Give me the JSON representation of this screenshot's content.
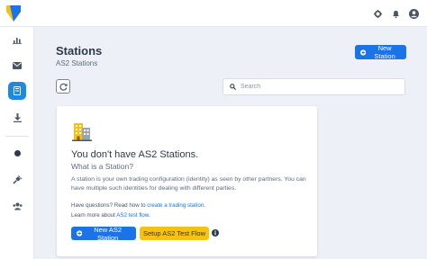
{
  "header": {
    "logo": "app-logo",
    "icons": [
      "gear-icon",
      "bell-icon",
      "user-circle-icon"
    ]
  },
  "sidebar": {
    "items": [
      {
        "icon": "bar-chart-icon",
        "active": false
      },
      {
        "icon": "envelope-icon",
        "active": false
      },
      {
        "icon": "station-icon",
        "active": true
      },
      {
        "icon": "download-icon",
        "active": false
      },
      {
        "icon": "circle-icon",
        "active": false
      },
      {
        "icon": "plug-icon",
        "active": false
      },
      {
        "icon": "users-icon",
        "active": false
      }
    ]
  },
  "page": {
    "title": "Stations",
    "subtitle": "AS2 Stations",
    "new_station_label": "New Station"
  },
  "search": {
    "placeholder": "Search"
  },
  "empty_state": {
    "title": "You don't have AS2 Stations.",
    "question": "What is a Station?",
    "description": "A station is your own trading configuration (identity) as seen by other partners. You can have multiple such identities for dealing with different parties.",
    "help_prefix": "Have questions? Read how to ",
    "help_link": "create a trading station",
    "help_suffix": ".",
    "learn_prefix": "Learn more about ",
    "learn_link": "AS2 test flow",
    "learn_suffix": ".",
    "new_button": "New AS2 Station",
    "setup_button": "Setup AS2 Test Flow"
  },
  "colors": {
    "primary": "#1a73e8",
    "warning": "#f5c211",
    "background": "#edf1f7"
  }
}
